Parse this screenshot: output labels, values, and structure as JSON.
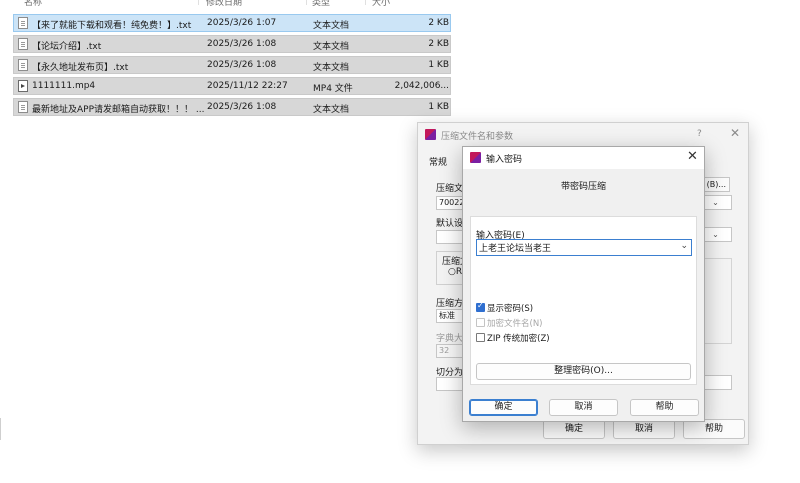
{
  "explorer": {
    "columns": [
      "名称",
      "修改日期",
      "类型",
      "大小"
    ],
    "files": [
      {
        "name": "【来了就能下载和观看！纯免费！】.txt",
        "date": "2025/3/26 1:07",
        "type": "文本文档",
        "size": "2 KB",
        "icon": "text-file-icon"
      },
      {
        "name": "【论坛介绍】.txt",
        "date": "2025/3/26 1:08",
        "type": "文本文档",
        "size": "2 KB",
        "icon": "text-file-icon"
      },
      {
        "name": "【永久地址发布页】.txt",
        "date": "2025/3/26 1:08",
        "type": "文本文档",
        "size": "1 KB",
        "icon": "text-file-icon"
      },
      {
        "name": "1111111.mp4",
        "date": "2025/11/12 22:27",
        "type": "MP4 文件",
        "size": "2,042,006...",
        "icon": "video-file-icon"
      },
      {
        "name": "最新地址及APP请发邮箱自动获取！！！ ...",
        "date": "2025/3/26 1:08",
        "type": "文本文档",
        "size": "1 KB",
        "icon": "text-file-icon"
      }
    ]
  },
  "archive_dialog": {
    "title": "压缩文件名和参数",
    "help": "?",
    "close": "✕",
    "tab_general": "常规",
    "labels": {
      "archive_name": "压缩文",
      "default_profile": "默认设",
      "archive_format": "压缩文",
      "compression_method": "压缩方",
      "dictionary_size": "字典大",
      "split": "切分为"
    },
    "values": {
      "archive_name": "70022",
      "format_radio": "R",
      "compression_method": "标准",
      "dictionary_size": "32"
    },
    "browse_button": "(B)...",
    "buttons": {
      "ok": "确定",
      "cancel": "取消",
      "help": "帮助"
    }
  },
  "password_dialog": {
    "title": "输入密码",
    "close": "✕",
    "subtitle": "带密码压缩",
    "password_label": "输入密码(E)",
    "password_value": "上老王论坛当老王",
    "options": [
      {
        "label": "显示密码(S)",
        "checked": true,
        "disabled": false
      },
      {
        "label": "加密文件名(N)",
        "checked": false,
        "disabled": true
      },
      {
        "label": "ZIP 传统加密(Z)",
        "checked": false,
        "disabled": false
      }
    ],
    "manage_button": "整理密码(O)...",
    "buttons": {
      "ok": "确定",
      "cancel": "取消",
      "help": "帮助"
    }
  }
}
